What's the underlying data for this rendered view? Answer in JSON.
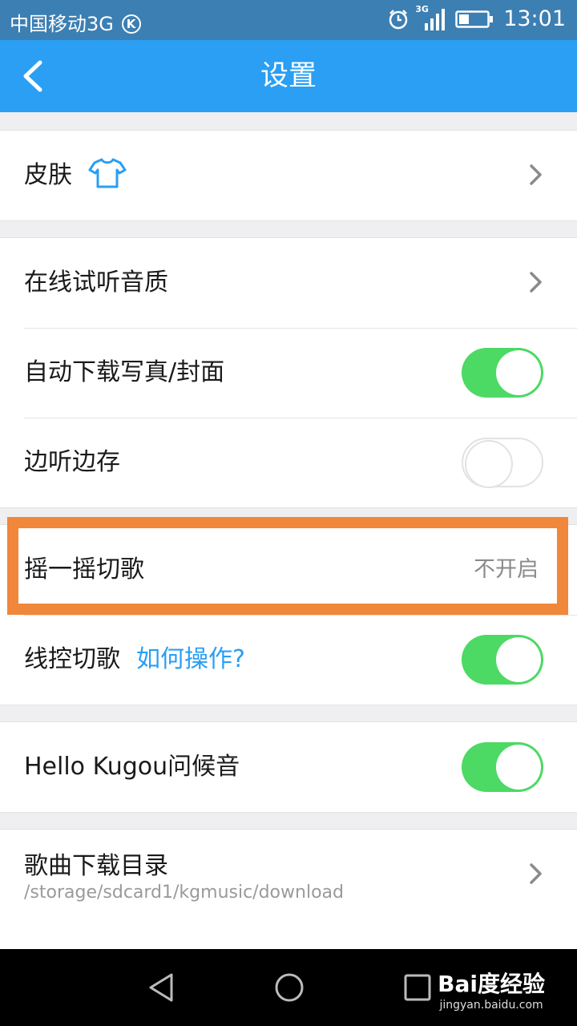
{
  "status_bar": {
    "carrier": "中国移动3G",
    "carrier_badge": "K",
    "network": "3G",
    "time": "13:01"
  },
  "app_bar": {
    "title": "设置"
  },
  "settings": {
    "skin": {
      "label": "皮肤"
    },
    "quality": {
      "label": "在线试听音质"
    },
    "auto_download": {
      "label": "自动下载写真/封面",
      "enabled": true
    },
    "cache_while_listening": {
      "label": "边听边存",
      "enabled": false
    },
    "shake": {
      "label": "摇一摇切歌",
      "value": "不开启"
    },
    "wire_control": {
      "label": "线控切歌",
      "help_link": "如何操作?",
      "enabled": true
    },
    "greeting": {
      "label": "Hello Kugou问候音",
      "enabled": true
    },
    "download_dir": {
      "label": "歌曲下载目录",
      "path": "/storage/sdcard1/kgmusic/download"
    }
  },
  "watermark": {
    "brand": "Bai度经验",
    "site": "jingyan.baidu.com"
  },
  "colors": {
    "accent": "#2a9ff3",
    "toggle_on": "#4cd964",
    "highlight": "#f0873a"
  }
}
